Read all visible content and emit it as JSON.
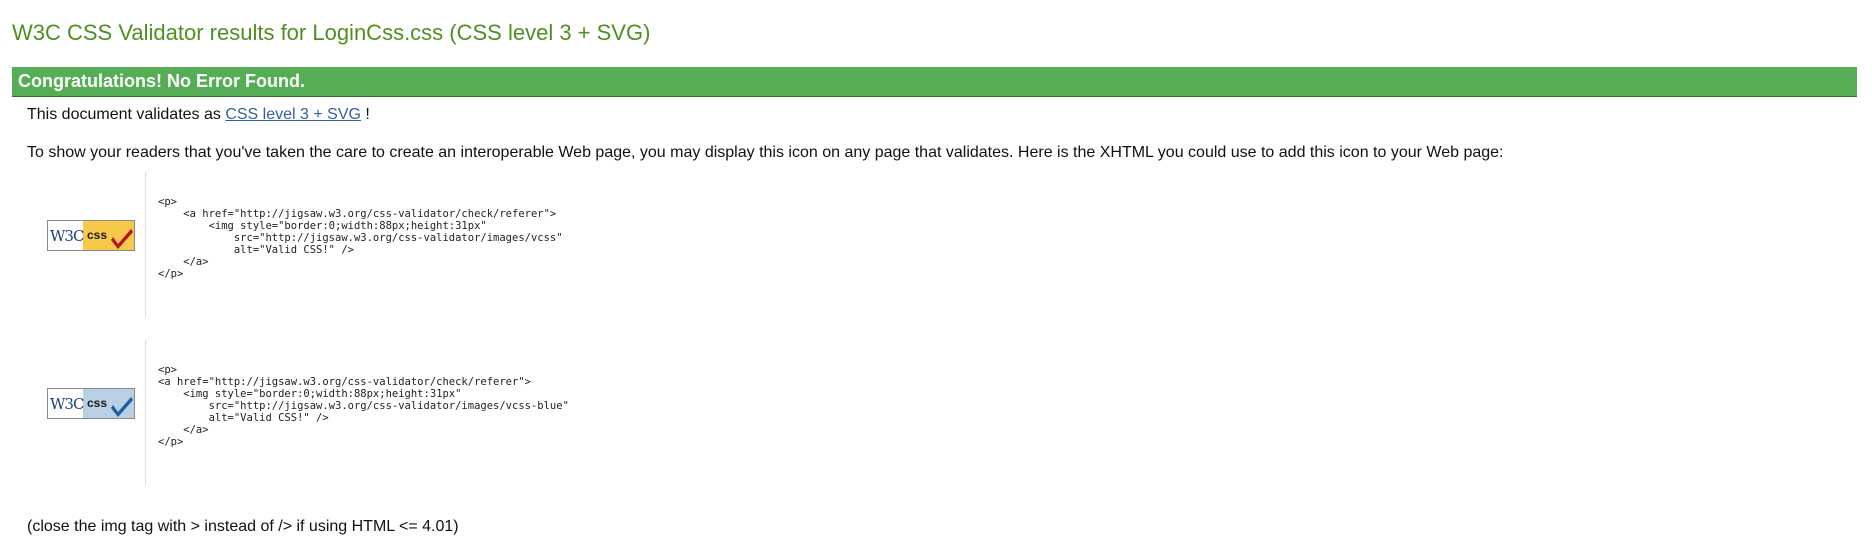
{
  "page": {
    "title": "W3C CSS Validator results for LoginCss.css (CSS level 3 + SVG)"
  },
  "banner": {
    "text": "Congratulations! No Error Found."
  },
  "validates": {
    "prefix": "This document validates as ",
    "link_text": "CSS level 3 + SVG",
    "suffix": " !"
  },
  "intro": {
    "text": "To show your readers that you've taken the care to create an interoperable Web page, you may display this icon on any page that validates. Here is the XHTML you could use to add this icon to your Web page:"
  },
  "badges": [
    {
      "icon": "w3c-css-valid-gold-icon",
      "badge_left": "W3C",
      "badge_right": "css",
      "colors": {
        "left_bg": "#ffffff",
        "right_bg": "#f7c94b",
        "check": "#b5121b",
        "text": "#1c3f77"
      },
      "code": "<p>\n    <a href=\"http://jigsaw.w3.org/css-validator/check/referer\">\n        <img style=\"border:0;width:88px;height:31px\"\n            src=\"http://jigsaw.w3.org/css-validator/images/vcss\"\n            alt=\"Valid CSS!\" />\n    </a>\n</p>"
    },
    {
      "icon": "w3c-css-valid-blue-icon",
      "badge_left": "W3C",
      "badge_right": "css",
      "colors": {
        "left_bg": "#ffffff",
        "right_bg": "#b9cfe3",
        "check": "#1f5fa0",
        "text": "#1c3f77"
      },
      "code": "<p>\n<a href=\"http://jigsaw.w3.org/css-validator/check/referer\">\n    <img style=\"border:0;width:88px;height:31px\"\n        src=\"http://jigsaw.w3.org/css-validator/images/vcss-blue\"\n        alt=\"Valid CSS!\" />\n    </a>\n</p>"
    }
  ],
  "note": {
    "text": "(close the img tag with > instead of /> if using HTML <= 4.01)"
  },
  "colors": {
    "title": "#4f8f21",
    "banner_bg": "#55ae55",
    "link": "#36609a"
  }
}
